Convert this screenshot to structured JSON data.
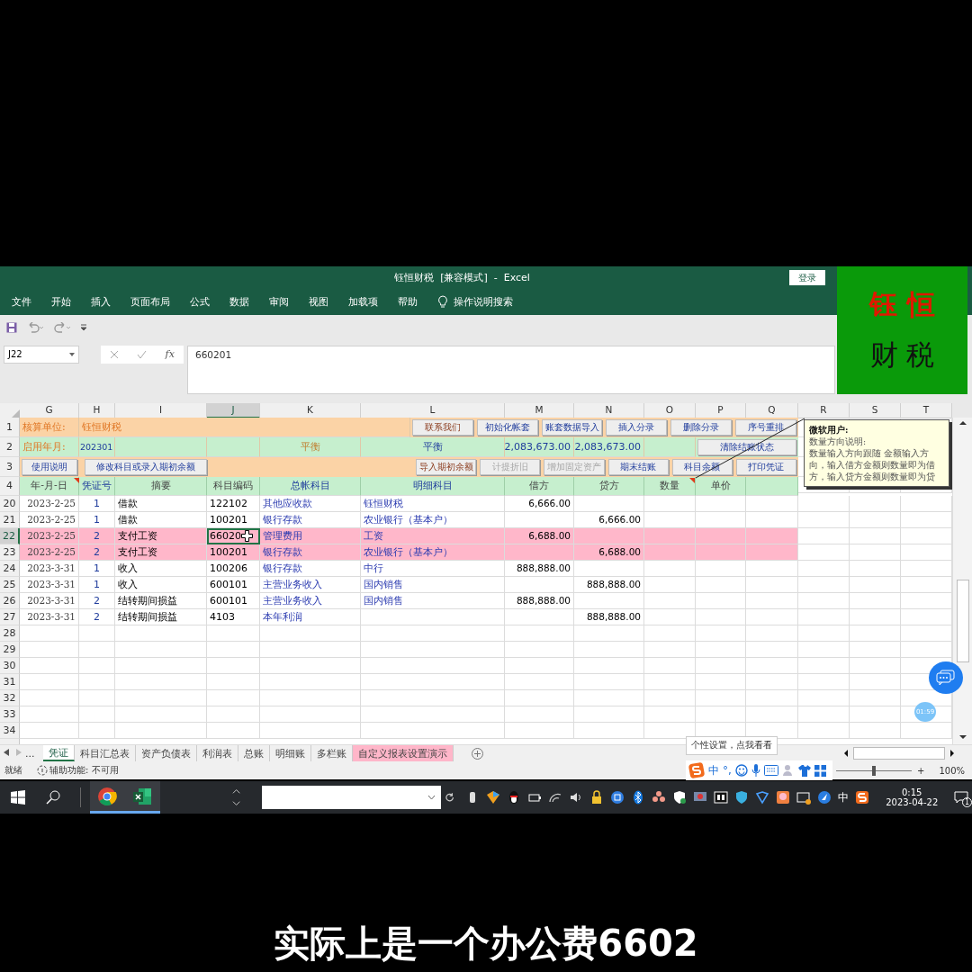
{
  "window": {
    "title": "钰恒财税  [兼容模式]  -  Excel",
    "login_button": "登录"
  },
  "ribbon": {
    "tabs": [
      "文件",
      "开始",
      "插入",
      "页面布局",
      "公式",
      "数据",
      "审阅",
      "视图",
      "加载项",
      "帮助"
    ],
    "search": "操作说明搜索"
  },
  "logo": {
    "line_1": "钰 恒",
    "line_2": "财 税"
  },
  "formula_bar": {
    "name_box": "J22",
    "fx_label": "fx",
    "formula": "660201"
  },
  "columns": [
    {
      "label": "G",
      "selected": false
    },
    {
      "label": "H",
      "selected": false
    },
    {
      "label": "I",
      "selected": false
    },
    {
      "label": "J",
      "selected": true
    },
    {
      "label": "K",
      "selected": false
    },
    {
      "label": "L",
      "selected": false
    },
    {
      "label": "M",
      "selected": false
    },
    {
      "label": "N",
      "selected": false
    },
    {
      "label": "O",
      "selected": false
    },
    {
      "label": "P",
      "selected": false
    },
    {
      "label": "Q",
      "selected": false
    },
    {
      "label": "R",
      "selected": false
    },
    {
      "label": "S",
      "selected": false
    },
    {
      "label": "T",
      "selected": false
    }
  ],
  "top_row_numbers": [
    "1",
    "2",
    "3",
    "4"
  ],
  "header": {
    "unit_label": "核算单位:",
    "unit_value": "钰恒财税",
    "start_label": "启用年月:",
    "start_value": "202301",
    "check_1": "平衡",
    "check_2": "平衡",
    "debit_total": "2,083,673.00",
    "credit_total": "2,083,673.00"
  },
  "row1_buttons": [
    {
      "label": "联系我们",
      "kind": "accent",
      "disabled": false
    },
    {
      "label": "初始化帐套",
      "kind": "standard",
      "disabled": false
    },
    {
      "label": "账套数据导入",
      "kind": "standard",
      "disabled": false
    },
    {
      "label": "插入分录",
      "kind": "standard",
      "disabled": false
    },
    {
      "label": "删除分录",
      "kind": "standard",
      "disabled": false
    },
    {
      "label": "序号重排",
      "kind": "standard",
      "disabled": false
    }
  ],
  "row2_buttons": [
    {
      "label": "清除结账状态",
      "kind": "standard",
      "disabled": false
    }
  ],
  "row3_left_buttons": [
    {
      "label": "使用说明",
      "kind": "standard",
      "disabled": false
    },
    {
      "label": "修改科目或录入期初余额",
      "kind": "standard",
      "disabled": false
    }
  ],
  "row3_right_buttons": [
    {
      "label": "导入期初余额",
      "kind": "accent",
      "disabled": false
    },
    {
      "label": "计提折旧",
      "kind": "standard",
      "disabled": true
    },
    {
      "label": "增加固定资产",
      "kind": "standard",
      "disabled": true
    },
    {
      "label": "期末结账",
      "kind": "standard",
      "disabled": false
    },
    {
      "label": "科目余额",
      "kind": "standard",
      "disabled": false
    },
    {
      "label": "打印凭证",
      "kind": "standard",
      "disabled": false
    }
  ],
  "column_headings": [
    "年-月-日",
    "凭证号",
    "摘要",
    "科目编码",
    "总帐科目",
    "明细科目",
    "借方",
    "贷方",
    "数量",
    "单价"
  ],
  "rows": [
    {
      "number": "20",
      "selected": false,
      "highlighted": false,
      "date": "2023-2-25",
      "voucher": "1",
      "summary": "借款",
      "code": "122102",
      "account": "其他应收款",
      "detail": "钰恒财税",
      "debit": "6,666.00"
    },
    {
      "number": "21",
      "selected": false,
      "highlighted": false,
      "date": "2023-2-25",
      "voucher": "1",
      "summary": "借款",
      "code": "100201",
      "account": "银行存款",
      "detail": "农业银行（基本户）",
      "credit": "6,666.00"
    },
    {
      "number": "22",
      "selected": true,
      "highlighted": true,
      "date": "2023-2-25",
      "voucher": "2",
      "summary": "支付工资",
      "code": "66020",
      "account": "管理费用",
      "detail": "工资",
      "debit": "6,688.00"
    },
    {
      "number": "23",
      "selected": false,
      "highlighted": true,
      "date": "2023-2-25",
      "voucher": "2",
      "summary": "支付工资",
      "code": "100201",
      "account": "银行存款",
      "detail": "农业银行（基本户）",
      "credit": "6,688.00"
    },
    {
      "number": "24",
      "selected": false,
      "highlighted": false,
      "date": "2023-3-31",
      "voucher": "1",
      "summary": "收入",
      "code": "100206",
      "account": "银行存款",
      "detail": "中行",
      "debit": "888,888.00"
    },
    {
      "number": "25",
      "selected": false,
      "highlighted": false,
      "date": "2023-3-31",
      "voucher": "1",
      "summary": "收入",
      "code": "600101",
      "account": "主营业务收入",
      "detail": "国内销售",
      "credit": "888,888.00"
    },
    {
      "number": "26",
      "selected": false,
      "highlighted": false,
      "date": "2023-3-31",
      "voucher": "2",
      "summary": "结转期间损益",
      "code": "600101",
      "account": "主营业务收入",
      "detail": "国内销售",
      "debit": "888,888.00"
    },
    {
      "number": "27",
      "selected": false,
      "highlighted": false,
      "date": "2023-3-31",
      "voucher": "2",
      "summary": "结转期间损益",
      "code": "4103",
      "account": "本年利润",
      "credit": "888,888.00"
    }
  ],
  "empty_rows": [
    "28",
    "29",
    "30",
    "31",
    "32",
    "33",
    "34"
  ],
  "comment": {
    "author": "微软用户:",
    "title": "数量方向说明:",
    "body": "数量输入方向跟随 金额输入方向，输入借方金额则数量即为借方，输入贷方金额则数量即为贷"
  },
  "timer": "01:59",
  "sheet_tabs": {
    "more": "...",
    "tabs": [
      {
        "label": "凭证",
        "selected": true
      },
      {
        "label": "科目汇总表",
        "selected": false
      },
      {
        "label": "资产负债表",
        "selected": false
      },
      {
        "label": "利润表",
        "selected": false
      },
      {
        "label": "总账",
        "selected": false
      },
      {
        "label": "明细账",
        "selected": false
      },
      {
        "label": "多栏账",
        "selected": false
      },
      {
        "label": "自定义报表设置演示",
        "selected": false,
        "color": "#ffb6c9"
      }
    ]
  },
  "ime": {
    "tooltip": "个性设置，点我看看",
    "mode": "中",
    "punctuation": "°,"
  },
  "status_bar": {
    "ready": "就绪",
    "accessibility": "辅助功能: 不可用",
    "zoom_in": "+",
    "zoom": {
      "level": 0.5
    },
    "zoom_reading": "100%"
  },
  "taskbar": {
    "apps": [
      {
        "kind": "chrome",
        "running": true
      },
      {
        "kind": "excel",
        "running": true
      }
    ],
    "input_mode": "中",
    "time": "0:15",
    "date": "2023-04-22",
    "notifications": "1"
  },
  "subtitle": "实际上是一个办公费6602"
}
